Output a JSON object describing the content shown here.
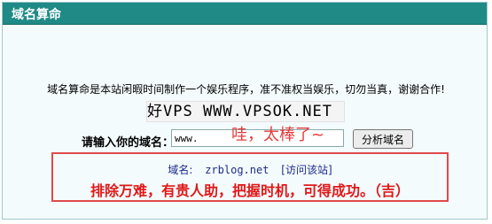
{
  "header": {
    "title": "域名算命"
  },
  "intro": {
    "text": "域名算命是本站闲暇时间制作一个娱乐程序，准不准权当娱乐，切勿当真，谢谢合作!"
  },
  "captcha": {
    "text": "好VPS WWW.VPSOK.NET"
  },
  "form": {
    "label": "请输入你的域名：",
    "input_value": "www.",
    "overlay_note": "哇，太棒了~",
    "button_label": "分析域名"
  },
  "result": {
    "domain_label": "域名:",
    "domain_value": "zrblog.net",
    "visit_link": "[访问该站]",
    "fortune": "排除万难，有贵人助，把握时机，可得成功。（吉）"
  },
  "colors": {
    "header_bg": "#1f8a86",
    "highlight_red": "#e01818",
    "link_blue": "#1b2a8a"
  }
}
